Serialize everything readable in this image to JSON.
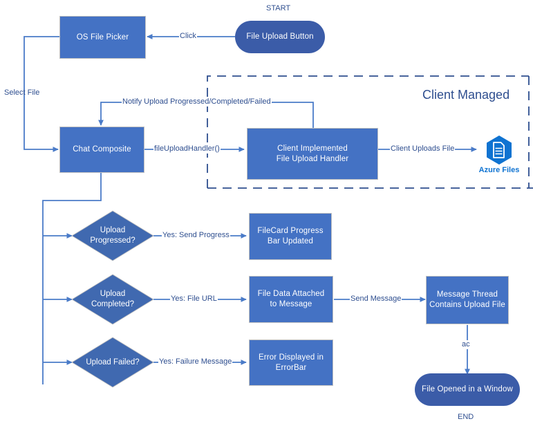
{
  "diagram": {
    "title": "File Upload Flow",
    "colors": {
      "rect_fill": "#4472C4",
      "diamond_fill": "#4069B0",
      "round_fill": "#3B5CA8",
      "edge": "#4A7BC8",
      "text_blue": "#2E4E8F",
      "azure_blue": "#0F73D1"
    },
    "labels": {
      "start": "START",
      "end": "END",
      "group": "Client Managed",
      "azure_caption": "Azure Files"
    },
    "nodes": {
      "file_upload_button": "File Upload Button",
      "os_file_picker": "OS File Picker",
      "chat_composite": "Chat Composite",
      "client_handler_line1": "Client Implemented",
      "client_handler_line2": "File Upload Handler",
      "upload_progressed_line1": "Upload",
      "upload_progressed_line2": "Progressed?",
      "upload_completed_line1": "Upload",
      "upload_completed_line2": "Completed?",
      "upload_failed": "Upload Failed?",
      "filecard_line1": "FileCard Progress",
      "filecard_line2": "Bar Updated",
      "filedata_line1": "File Data Attached",
      "filedata_line2": "to Message",
      "error_line1": "Error Displayed in",
      "error_line2": "ErrorBar",
      "message_thread_line1": "Message Thread",
      "message_thread_line2": "Contains Upload File",
      "file_opened": "File Opened in a Window"
    },
    "edges": {
      "click": "Click",
      "select_file": "Select File",
      "file_upload_handler": "fileUploadHandler()",
      "notify": "Notify Upload Progressed/Completed/Failed",
      "client_uploads_file": "Client Uploads File",
      "yes_send_progress": "Yes: Send Progress",
      "yes_file_url": "Yes: File URL",
      "yes_failure_message": "Yes: Failure Message",
      "send_message": "Send Message",
      "ac": "ac"
    }
  }
}
